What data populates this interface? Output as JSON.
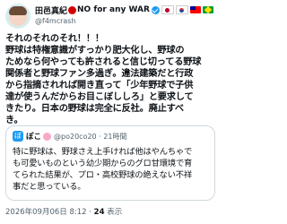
{
  "author": {
    "name": "田邑真紀",
    "name_suffix": "NO for any WAR",
    "handle": "@f4mcrash"
  },
  "post": {
    "lines": [
      "それのそれのそれ！！！",
      "野球は特権意識がすっかり肥大化し、野球の",
      "ためなら何やっても許されると信じ切ってる野球",
      "関係者と野球ファン多過ぎ。違法建築だと行政",
      "から指摘されれば開き直って「少年野球で子供",
      "達が使うんだからお目こぼししろ」と要求して",
      "きたり。日本の野球は完全に反社。廃止すべ",
      "き。"
    ]
  },
  "quote": {
    "avatar_letter": "ぼ",
    "name": "ぽこ",
    "handle": "@po20co20",
    "time": "21時間",
    "lines": [
      "特に野球は、野球さえ上手ければ他はやんちゃで",
      "も可愛いものという幼少期からのグロ甘環境で育",
      "てられた結果が、プロ・高校野球の絶えない不祥",
      "事だと思っている。"
    ]
  },
  "footer": {
    "timestamp": "2026年09月06日 8:12",
    "separator": "·",
    "views_count": "24",
    "views_label": "表示"
  },
  "colors": {
    "accent": "#1d9bf0",
    "muted": "#536471",
    "text": "#0f1419",
    "red_dot": "#d40000"
  },
  "icons": [
    "verified-badge-icon",
    "red-circle-icon",
    "flag-japan-icon",
    "flag-korea-icon",
    "flag-taiwan-icon",
    "flag-brazil-icon"
  ]
}
